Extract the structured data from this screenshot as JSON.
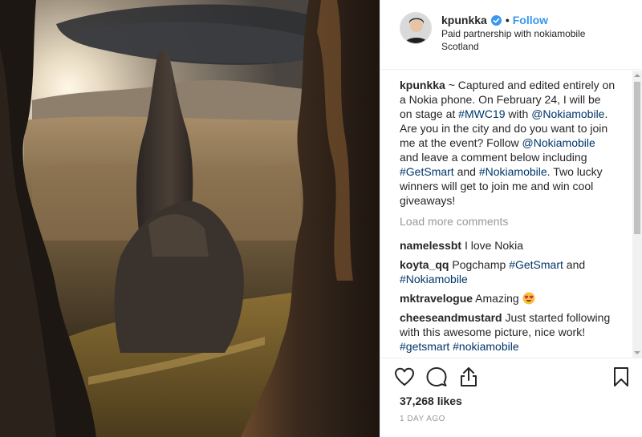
{
  "post": {
    "username": "kpunkka",
    "follow_label": "Follow",
    "separator": "•",
    "paid_partnership": "Paid partnership with nokiamobile",
    "location": "Scotland"
  },
  "caption": {
    "username": "kpunkka",
    "parts": [
      " ~ Captured and edited entirely on a Nokia phone. On February 24, I will be on stage at ",
      "#MWC19",
      " with ",
      "@Nokiamobile",
      ". Are you in the city and do you want to join me at the event? Follow ",
      "@Nokiamobile",
      " and leave a comment below including ",
      "#GetSmart",
      " and ",
      "#Nokiamobile",
      ". Two lucky winners will get to join me and win cool giveaways!"
    ]
  },
  "load_more": "Load more comments",
  "comments": [
    {
      "username": "namelessbt",
      "text": "I love Nokia"
    },
    {
      "username": "koyta_qq",
      "text_before": "Pogchamp ",
      "tag1": "#GetSmart",
      "text_mid": " and ",
      "tag2": "#Nokiamobile"
    },
    {
      "username": "mktravelogue",
      "text": "Amazing",
      "emoji": "heart-eyes-emoji"
    },
    {
      "username": "cheeseandmustard",
      "text": "Just started following with this awesome picture, nice work! ",
      "tag1": "#getsmart",
      "text_mid": " ",
      "tag2": "#nokiamobile"
    }
  ],
  "likes": "37,268 likes",
  "time_ago": "1 DAY AGO",
  "icons": {
    "verified": "verified-badge-icon",
    "like": "heart-icon",
    "comment": "comment-icon",
    "share": "share-icon",
    "save": "bookmark-icon"
  },
  "colors": {
    "link_blue": "#3897f0",
    "hashtag": "#003569",
    "muted": "#999999",
    "text": "#262626"
  }
}
